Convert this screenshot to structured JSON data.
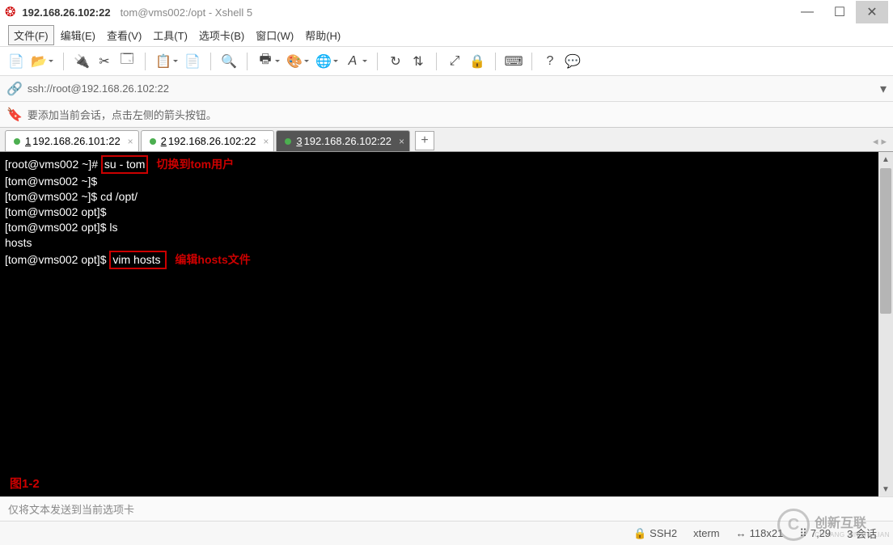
{
  "window": {
    "title_main": "192.168.26.102:22",
    "title_sub": "tom@vms002:/opt - Xshell 5"
  },
  "menu": {
    "file": "文件(F)",
    "edit": "编辑(E)",
    "view": "查看(V)",
    "tools": "工具(T)",
    "tab": "选项卡(B)",
    "window": "窗口(W)",
    "help": "帮助(H)"
  },
  "address": {
    "url": "ssh://root@192.168.26.102:22"
  },
  "hint": {
    "text": "要添加当前会话，点击左侧的箭头按钮。"
  },
  "tabs": [
    {
      "num": "1",
      "label": "192.168.26.101:22",
      "active": false
    },
    {
      "num": "2",
      "label": "192.168.26.102:22",
      "active": false
    },
    {
      "num": "3",
      "label": "192.168.26.102:22",
      "active": true
    }
  ],
  "terminal": {
    "l1_prompt": "[root@vms002 ~]# ",
    "l1_cmd": "su - tom",
    "l1_ann": "切换到tom用户",
    "l2": "[tom@vms002 ~]$",
    "l3": "[tom@vms002 ~]$ cd /opt/",
    "l4": "[tom@vms002 opt]$",
    "l5": "[tom@vms002 opt]$ ls",
    "l6": "hosts",
    "l7_prompt": "[tom@vms002 opt]$ ",
    "l7_cmd": "vim hosts ",
    "l7_ann": "编辑hosts文件",
    "figlabel": "图1-2"
  },
  "sendbar": {
    "text": "仅将文本发送到当前选项卡"
  },
  "status": {
    "proto": "SSH2",
    "term": "xterm",
    "size": "118x21",
    "cursor": "7,29",
    "sessions": "3 会话"
  },
  "watermark": {
    "cn": "创新互联",
    "en": "CHUANG XIN HU LIAN"
  }
}
